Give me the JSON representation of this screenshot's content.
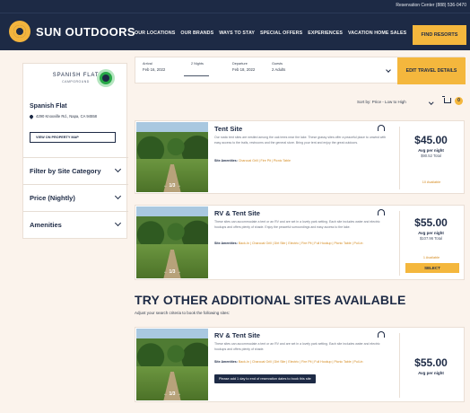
{
  "header": {
    "reservation_text": "Reservation Center (888) 536-0470",
    "brand": "SUN OUTDOORS",
    "nav": [
      "OUR LOCATIONS",
      "OUR BRANDS",
      "WAYS TO STAY",
      "SPECIAL OFFERS",
      "EXPERIENCES",
      "VACATION HOME SALES"
    ],
    "find_button": "FIND RESORTS"
  },
  "sidebar": {
    "logo_text": "SPANISH FLAT",
    "logo_sub": "CAMPGROUND",
    "park_name": "Spanish Flat",
    "address": "4290 Knoxville Rd., Napa, CA 94558",
    "map_button": "VIEW ON PROPERTY MAP",
    "filters": [
      "Filter by Site Category",
      "Price (Nightly)",
      "Amenities"
    ]
  },
  "search": {
    "arrival_label": "Arrival",
    "arrival_value": "Feb 16, 2022",
    "nights_label": "2 Nights",
    "departure_label": "Departure",
    "departure_value": "Feb 18, 2022",
    "guests_label": "Guests",
    "guests_value": "2 Adults",
    "edit_button": "EDIT TRAVEL DETAILS"
  },
  "sort": {
    "label": "Sort by: Price - Low to High",
    "cart_count": "0"
  },
  "sites": [
    {
      "title": "Tent Site",
      "description": "Our rustic tent sites are nestled among the oak trees near the lake. These grassy sites offer a peaceful place to unwind with easy access to the trails, restrooms and the general store. Bring your tent and enjoy the great outdoors.",
      "amenities_label": "Site Amenities:",
      "amenities": "Charcoal Grill | Fire Pit | Picnic Table",
      "price": "$45.00",
      "per": "Avg per night",
      "total": "$90.52 Total",
      "availability": "10 Available",
      "photo_nav": "←  1/3  →"
    },
    {
      "title": "RV & Tent Site",
      "description": "These sites can accommodate a tent or an RV and are set in a lovely park setting. Each site includes water and electric hookups and offers plenty of shade. Enjoy the peaceful surroundings and easy access to the lake.",
      "amenities_label": "Site Amenities:",
      "amenities": "Back-In | Charcoal Grill | Dirt Site | Electric | Fire Pit | Full Hookup | Picnic Table | Pull-in",
      "price": "$55.00",
      "per": "Avg per night",
      "total": "$107.96 Total",
      "availability": "1 Available",
      "select_button": "SELECT",
      "photo_nav": "←  1/3  →"
    }
  ],
  "other": {
    "title": "TRY OTHER ADDITIONAL SITES AVAILABLE",
    "subtitle": "Adjust your search criteria to book the following sites:",
    "site": {
      "title": "RV & Tent Site",
      "description": "These sites can accommodate a tent or an RV and are set in a lovely park setting. Each site includes water and electric hookups and offers plenty of shade.",
      "amenities_label": "Site Amenities:",
      "amenities": "Back-In | Charcoal Grill | Dirt Site | Electric | Fire Pit | Full Hookup | Picnic Table | Pull-in",
      "tooltip": "Please add 1 day to end of reservation dates to book this site",
      "price": "$55.00",
      "per": "Avg per night",
      "photo_nav": "←  1/3  →"
    }
  }
}
